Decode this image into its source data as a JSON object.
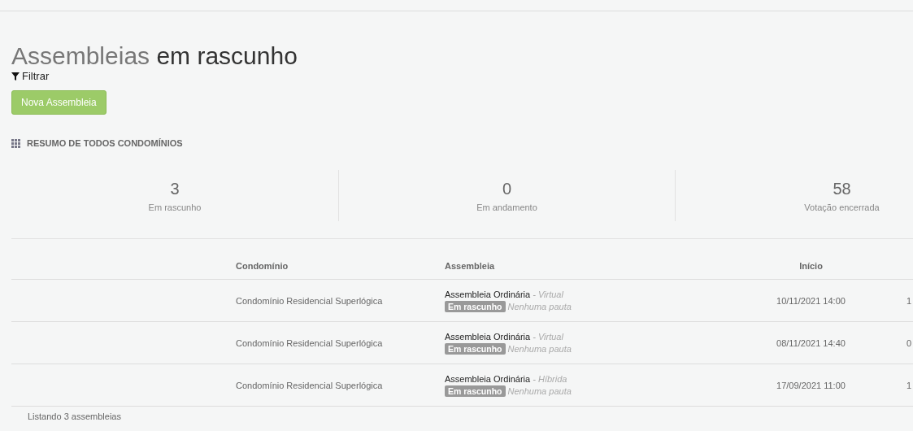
{
  "title": {
    "part_1": "Assembleias",
    "part_2": "em rascunho"
  },
  "filter": {
    "label": "Filtrar"
  },
  "new_button": {
    "label": "Nova Assembleia"
  },
  "summary": {
    "heading": "RESUMO DE TODOS CONDOMÍNIOS",
    "stats": [
      {
        "value": "3",
        "label": "Em rascunho"
      },
      {
        "value": "0",
        "label": "Em andamento"
      },
      {
        "value": "58",
        "label": "Votação encerrada"
      }
    ]
  },
  "table": {
    "columns": [
      "Condomínio",
      "Assembleia",
      "Início"
    ],
    "rows": [
      {
        "condominio": "Condomínio Residencial Superlógica",
        "assembleia": "Assembleia Ordinária",
        "modo": "- Virtual",
        "status": "Em rascunho",
        "pauta": "Nenhuma pauta",
        "inicio": "10/11/2021 14:00",
        "column_5": "1"
      },
      {
        "condominio": "Condomínio Residencial Superlógica",
        "assembleia": "Assembleia Ordinária",
        "modo": "- Virtual",
        "status": "Em rascunho",
        "pauta": "Nenhuma pauta",
        "inicio": "08/11/2021 14:40",
        "column_5": "0"
      },
      {
        "condominio": "Condomínio Residencial Superlógica",
        "assembleia": "Assembleia Ordinária",
        "modo": "- Híbrida",
        "status": "Em rascunho",
        "pauta": "Nenhuma pauta",
        "inicio": "17/09/2021 11:00",
        "column_5": "1"
      }
    ]
  },
  "footer": "Listando 3 assembleias"
}
